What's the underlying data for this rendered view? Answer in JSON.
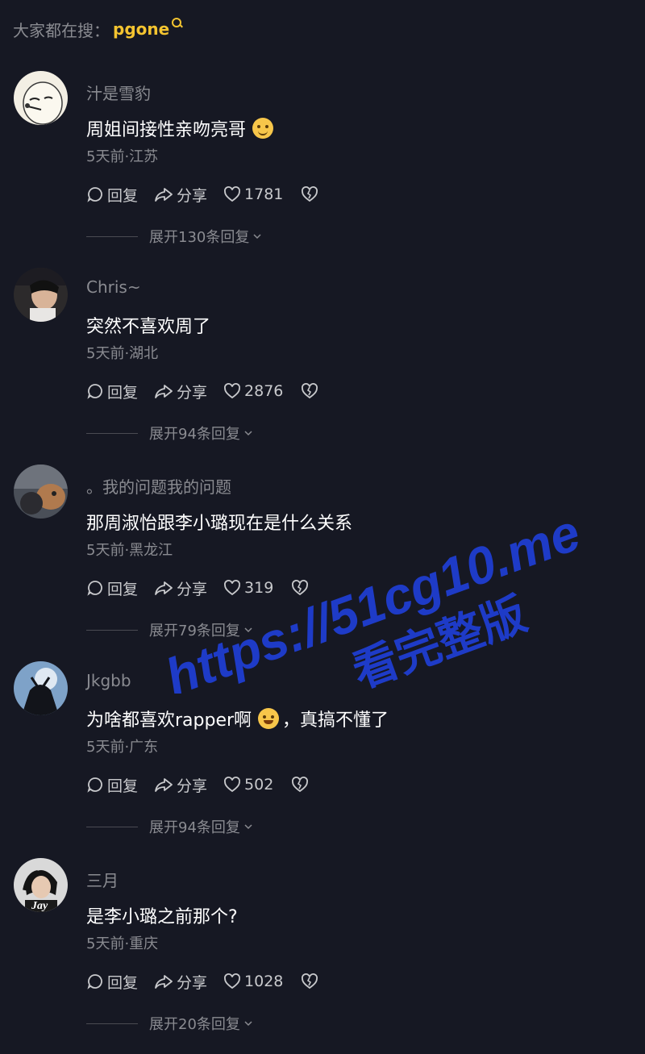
{
  "search": {
    "prefix": "大家都在搜：",
    "term": "pgone"
  },
  "comments": [
    {
      "username": "汁是雪豹",
      "text": "周姐间接性亲吻亮哥",
      "emoji": "smile-emoji",
      "meta": "5天前·江苏",
      "reply": "回复",
      "share": "分享",
      "likes": "1781",
      "expand": "展开130条回复"
    },
    {
      "username": "Chris~",
      "text": "突然不喜欢周了",
      "meta": "5天前·湖北",
      "reply": "回复",
      "share": "分享",
      "likes": "2876",
      "expand": "展开94条回复"
    },
    {
      "username": "。我的问题我的问题",
      "text": "那周淑怡跟李小璐现在是什么关系",
      "meta": "5天前·黑龙江",
      "reply": "回复",
      "share": "分享",
      "likes": "319",
      "expand": "展开79条回复"
    },
    {
      "username": "Jkgbb",
      "text_before": "为啥都喜欢rapper啊",
      "emoji": "rofl-emoji",
      "text_after": "，真搞不懂了",
      "meta": "5天前·广东",
      "reply": "回复",
      "share": "分享",
      "likes": "502",
      "expand": "展开94条回复"
    },
    {
      "username": "三月",
      "text": "是李小璐之前那个?",
      "meta": "5天前·重庆",
      "reply": "回复",
      "share": "分享",
      "likes": "1028",
      "expand": "展开20条回复",
      "avatar_text": "Jay"
    }
  ],
  "watermark": {
    "url": "https://51cg10.me",
    "line2": "看完整版",
    "color": "#1f3fd6"
  }
}
